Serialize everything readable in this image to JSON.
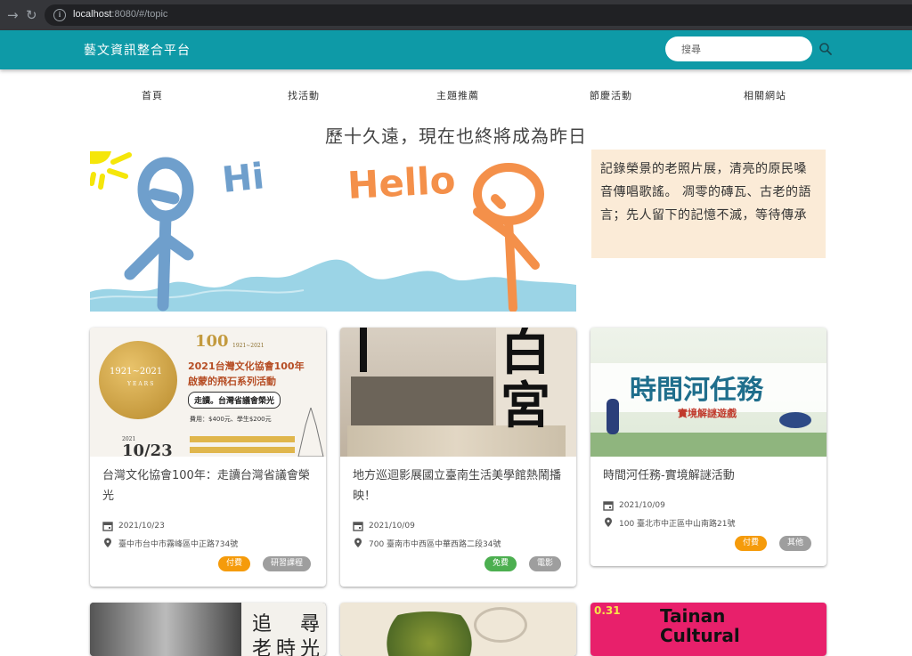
{
  "browser": {
    "url_host": "localhost",
    "url_rest": ":8080/#/topic"
  },
  "app": {
    "brand": "藝文資訊整合平台",
    "search_placeholder": "搜尋"
  },
  "nav": {
    "items": [
      {
        "label": "首頁"
      },
      {
        "label": "找活動"
      },
      {
        "label": "主題推薦"
      },
      {
        "label": "節慶活動"
      },
      {
        "label": "相關網站"
      }
    ]
  },
  "headline": "歷十久遠，現在也終將成為昨日",
  "banner": {
    "text_hi": "Hi",
    "text_hello": "Hello"
  },
  "quote": "記錄榮景的老照片展，清亮的原民嗓音傳唱歌謠。 凋零的磚瓦、古老的語言；先人留下的記憶不滅，等待傳承",
  "cards": [
    {
      "title": "台灣文化協會100年：走讀台灣省議會榮光",
      "date": "2021/10/23",
      "address": "臺中市台中市霧峰區中正路734號",
      "chips": [
        {
          "label": "付費",
          "color": "orange"
        },
        {
          "label": "研習課程",
          "color": "grey"
        }
      ],
      "img": {
        "medal_top": "1921~2021",
        "medal_bottom": "YEARS",
        "line1": "2021台灣文化協會100年",
        "line2": "啟蒙的飛石系列活動",
        "pill": "走讀。台灣省議會榮光",
        "fee": "費用：$400元、學生$200元",
        "date_big": "10/23",
        "year_small": "2021",
        "badge_100": "100",
        "badge_range": "1921~2021"
      }
    },
    {
      "title": "地方巡迴影展國立臺南生活美學館熱鬧播映！",
      "date": "2021/10/09",
      "address": "700 臺南市中西區中華西路二段34號",
      "chips": [
        {
          "label": "免費",
          "color": "green"
        },
        {
          "label": "電影",
          "color": "grey"
        }
      ],
      "img": {
        "calligraphy": "白宮"
      }
    },
    {
      "title": "時間河任務-實境解謎活動",
      "date": "2021/10/09",
      "address": "100 臺北市中正區中山南路21號",
      "chips": [
        {
          "label": "付費",
          "color": "orange"
        },
        {
          "label": "其他",
          "color": "grey"
        }
      ],
      "img": {
        "title": "時間河任務",
        "subtitle": "實境解謎遊戲"
      }
    }
  ],
  "bottom_cards": [
    {
      "img_text_a": "追",
      "img_text_b": "尋",
      "img_text_c": "老",
      "img_text_d": "時",
      "img_text_e": "光"
    },
    {},
    {
      "img_text_date": "0.31",
      "img_text_title": "Tainan Cultural"
    }
  ]
}
